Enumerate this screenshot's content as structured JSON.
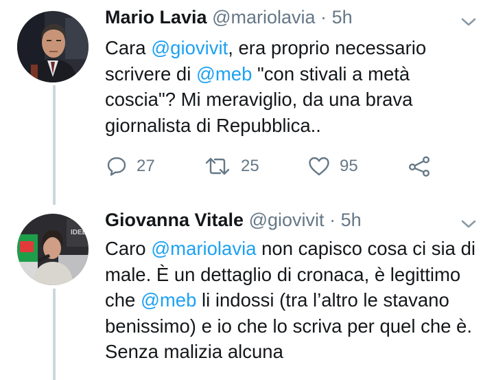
{
  "tweets": [
    {
      "name": "Mario Lavia",
      "handle": "@mariolavia",
      "sep": "·",
      "time": "5h",
      "text": [
        {
          "t": "Cara "
        },
        {
          "t": "@giovivit",
          "m": true
        },
        {
          "t": ", era proprio necessario scrivere di "
        },
        {
          "t": "@meb",
          "m": true
        },
        {
          "t": " \"con stivali a metà coscia\"? Mi meraviglio, da una brava giornalista di Repubblica.."
        }
      ],
      "avatar_icon": "man-portrait",
      "actions": {
        "reply": "27",
        "retweet": "25",
        "like": "95"
      }
    },
    {
      "name": "Giovanna Vitale",
      "handle": "@giovivit",
      "sep": "·",
      "time": "5h",
      "text": [
        {
          "t": "Caro "
        },
        {
          "t": "@mariolavia",
          "m": true
        },
        {
          "t": " non capisco cosa ci sia di male. È un dettaglio di cronaca, è legittimo che "
        },
        {
          "t": "@meb",
          "m": true
        },
        {
          "t": " li indossi (tra l’altro le stavano benissimo) e io che lo scriva per quel che è. Senza malizia alcuna"
        }
      ],
      "avatar_icon": "woman-speaking-portrait"
    }
  ],
  "icons": {
    "reply": "reply-icon",
    "retweet": "retweet-icon",
    "like": "heart-icon",
    "share": "share-icon",
    "menu": "chevron-down-icon"
  },
  "colors": {
    "mention": "#1da1f2",
    "meta": "#657786",
    "thread_line": "#ccd6dd"
  }
}
